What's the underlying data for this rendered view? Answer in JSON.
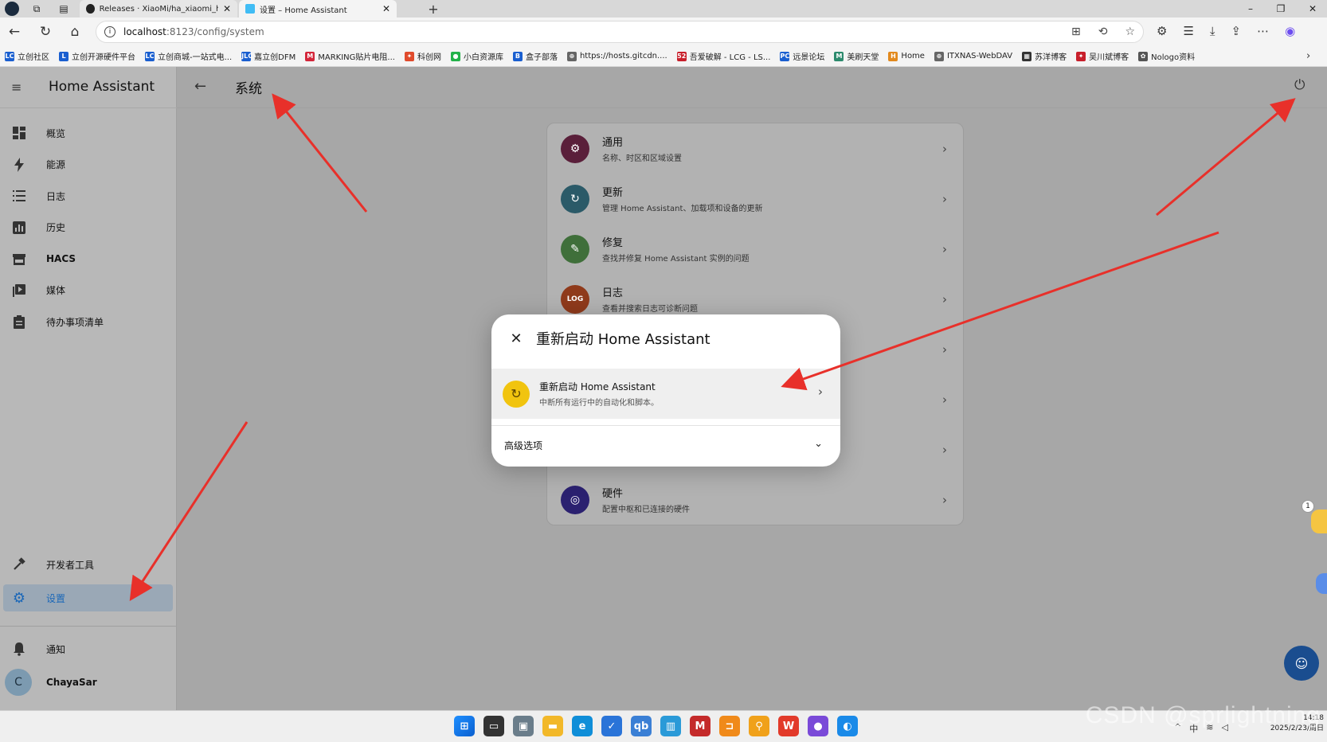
{
  "browser": {
    "tabs": [
      {
        "title": "Releases · XiaoMi/ha_xiaomi_hom",
        "active": false
      },
      {
        "title": "设置 – Home Assistant",
        "active": true
      }
    ],
    "url_host": "localhost",
    "url_rest": ":8123/config/system",
    "bookmarks": [
      {
        "label": "立创社区",
        "icon": "LC",
        "color": "#1a5fd0"
      },
      {
        "label": "立创开源硬件平台",
        "icon": "L",
        "color": "#1a5fd0"
      },
      {
        "label": "立创商城-一站式电...",
        "icon": "LC",
        "color": "#1a5fd0"
      },
      {
        "label": "嘉立创DFM",
        "icon": "JLC",
        "color": "#1a5fd0"
      },
      {
        "label": "MARKING贴片电阻...",
        "icon": "M",
        "color": "#d4263a"
      },
      {
        "label": "科创网",
        "icon": "✦",
        "color": "#e04b2c"
      },
      {
        "label": "小白资源库",
        "icon": "●",
        "color": "#23b24a"
      },
      {
        "label": "盒子部落",
        "icon": "B",
        "color": "#1a5fd0"
      },
      {
        "label": "https://hosts.gitcdn....",
        "icon": "⊕",
        "color": "#666666"
      },
      {
        "label": "吾爱破解 - LCG - LS...",
        "icon": "52",
        "color": "#c81f2b"
      },
      {
        "label": "远景论坛",
        "icon": "PC",
        "color": "#1a5fd0"
      },
      {
        "label": "美刷天堂",
        "icon": "M",
        "color": "#2c8a6d"
      },
      {
        "label": "Home",
        "icon": "H",
        "color": "#e2891d"
      },
      {
        "label": "ITXNAS-WebDAV",
        "icon": "⊕",
        "color": "#666666"
      },
      {
        "label": "苏洋博客",
        "icon": "▦",
        "color": "#333333"
      },
      {
        "label": "吴川斌博客",
        "icon": "✦",
        "color": "#c81f2b"
      },
      {
        "label": "Nologo资料",
        "icon": "✿",
        "color": "#555555"
      }
    ]
  },
  "ha": {
    "app_title": "Home Assistant",
    "nav": [
      {
        "label": "概览",
        "icon": "dashboard-icon",
        "bold": false
      },
      {
        "label": "能源",
        "icon": "lightning-icon",
        "bold": false
      },
      {
        "label": "日志",
        "icon": "list-icon",
        "bold": false
      },
      {
        "label": "历史",
        "icon": "chart-icon",
        "bold": false
      },
      {
        "label": "HACS",
        "icon": "hacs-icon",
        "bold": true
      },
      {
        "label": "媒体",
        "icon": "media-icon",
        "bold": false
      },
      {
        "label": "待办事项清单",
        "icon": "clipboard-icon",
        "bold": false
      }
    ],
    "dev_tools": "开发者工具",
    "settings": "设置",
    "notifications": "通知",
    "user_initial": "C",
    "user_name": "ChayaSar",
    "page_title": "系统",
    "system_rows": [
      {
        "title": "通用",
        "subtitle": "名称、时区和区域设置",
        "color": "#5a1f3a",
        "glyph": "⚙"
      },
      {
        "title": "更新",
        "subtitle": "管理 Home Assistant、加载项和设备的更新",
        "color": "#2b5a68",
        "glyph": "↻"
      },
      {
        "title": "修复",
        "subtitle": "查找并修复 Home Assistant 实例的问题",
        "color": "#3f6f3a",
        "glyph": "✎"
      },
      {
        "title": "日志",
        "subtitle": "查看并搜索日志可诊断问题",
        "color": "#8f3a1b",
        "glyph": "LOG"
      },
      {
        "title": "硬件",
        "subtitle": "配置中枢和已连接的硬件",
        "color": "#2b2170",
        "glyph": "◎"
      }
    ],
    "dialog": {
      "title": "重新启动 Home Assistant",
      "option_title": "重新启动 Home Assistant",
      "option_subtitle": "中断所有运行中的自动化和脚本。",
      "advanced": "高级选项"
    }
  },
  "taskbar": {
    "time": "14:18",
    "date": "2025/2/23/周日",
    "lang": "中"
  },
  "watermark": "CSDN @sprlightning",
  "floating_badge": "1"
}
